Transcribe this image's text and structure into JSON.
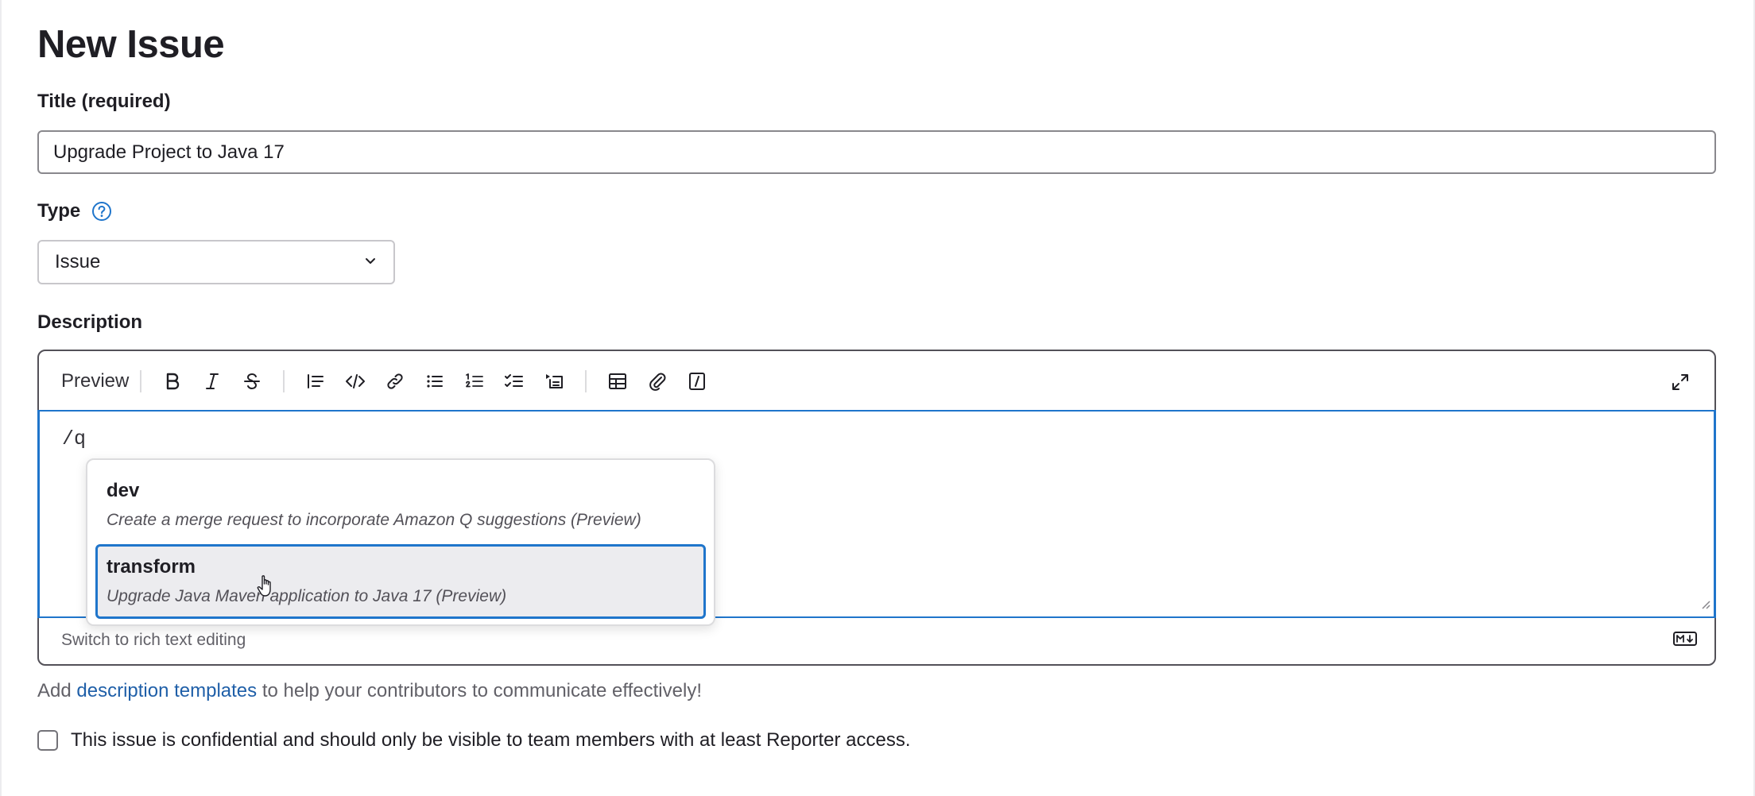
{
  "page": {
    "title": "New Issue"
  },
  "form": {
    "title_label": "Title (required)",
    "title_value": "Upgrade Project to Java 17",
    "type_label": "Type",
    "type_value": "Issue",
    "description_label": "Description"
  },
  "editor": {
    "preview_tab": "Preview",
    "content": "/q",
    "footer_switch": "Switch to rich text editing",
    "toolbar_icons": [
      "bold-icon",
      "italic-icon",
      "strikethrough-icon",
      "quote-icon",
      "code-icon",
      "link-icon",
      "bullet-list-icon",
      "numbered-list-icon",
      "task-list-icon",
      "collapsible-icon",
      "table-icon",
      "attach-icon",
      "quick-action-icon",
      "fullscreen-icon"
    ]
  },
  "autocomplete": {
    "items": [
      {
        "name": "dev",
        "description": "Create a merge request to incorporate Amazon Q suggestions (Preview)"
      },
      {
        "name": "transform",
        "description": "Upgrade Java Maven application to Java 17 (Preview)"
      }
    ],
    "selected_index": 1
  },
  "help": {
    "prefix": "Add",
    "link_text": "description templates",
    "suffix": "to help your contributors to communicate effectively!"
  },
  "confidential": {
    "label": "This issue is confidential and should only be visible to team members with at least Reporter access.",
    "checked": false
  },
  "colors": {
    "accent_blue": "#1f75cb",
    "link_blue": "#1f5fa8",
    "text": "#1f1e24"
  }
}
